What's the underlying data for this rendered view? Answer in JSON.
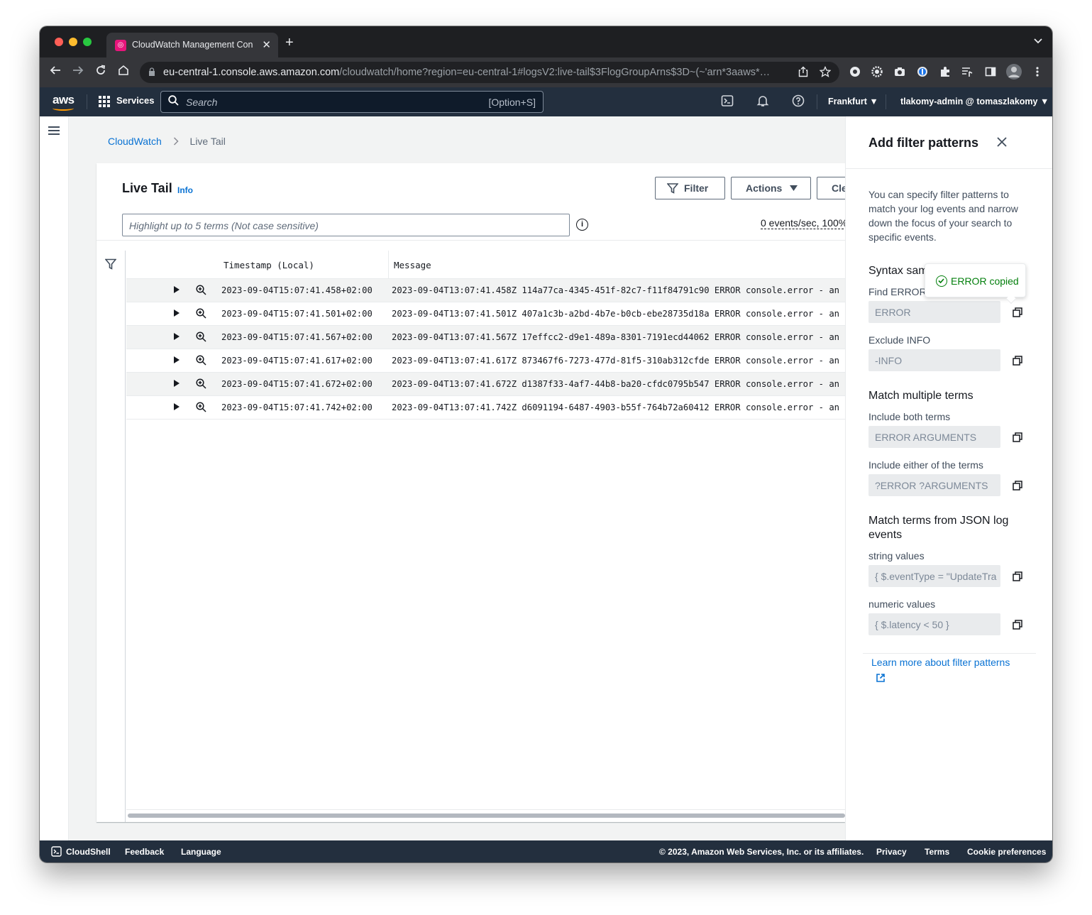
{
  "browser": {
    "tab_title": "CloudWatch Management Con",
    "url_host": "eu-central-1.console.aws.amazon.com",
    "url_path": "/cloudwatch/home?region=eu-central-1#logsV2:live-tail$3FlogGroupArns$3D~(~'arn*3aaws*…"
  },
  "aws_header": {
    "logo": "aws",
    "services_label": "Services",
    "search_placeholder": "Search",
    "search_shortcut": "[Option+S]",
    "region": "Frankfurt ▼",
    "user": "tlakomy-admin @ tomaszlakomy ▼"
  },
  "breadcrumb": {
    "root": "CloudWatch",
    "current": "Live Tail"
  },
  "live_tail": {
    "title": "Live Tail",
    "info_label": "Info",
    "filter_button": "Filter",
    "actions_button": "Actions",
    "clear_button": "Cle",
    "highlight_placeholder": "Highlight up to 5 terms (Not case sensitive)",
    "rate": "0 events/sec, 100%",
    "columns": [
      "Timestamp (Local)",
      "Message"
    ],
    "rows": [
      {
        "timestamp": "2023-09-04T15:07:41.458+02:00",
        "message": "2023-09-04T13:07:41.458Z 114a77ca-4345-451f-82c7-f11f84791c90 ERROR console.error - an er"
      },
      {
        "timestamp": "2023-09-04T15:07:41.501+02:00",
        "message": "2023-09-04T13:07:41.501Z 407a1c3b-a2bd-4b7e-b0cb-ebe28735d18a ERROR console.error - an er"
      },
      {
        "timestamp": "2023-09-04T15:07:41.567+02:00",
        "message": "2023-09-04T13:07:41.567Z 17effcc2-d9e1-489a-8301-7191ecd44062 ERROR console.error - an er"
      },
      {
        "timestamp": "2023-09-04T15:07:41.617+02:00",
        "message": "2023-09-04T13:07:41.617Z 873467f6-7273-477d-81f5-310ab312cfde ERROR console.error - an er"
      },
      {
        "timestamp": "2023-09-04T15:07:41.672+02:00",
        "message": "2023-09-04T13:07:41.672Z d1387f33-4af7-44b8-ba20-cfdc0795b547 ERROR console.error - an er"
      },
      {
        "timestamp": "2023-09-04T15:07:41.742+02:00",
        "message": "2023-09-04T13:07:41.742Z d6091194-6487-4903-b55f-764b72a60412 ERROR console.error - an er"
      }
    ]
  },
  "side_panel": {
    "title": "Add filter patterns",
    "description": "You can specify filter patterns to match your log events and narrow down the focus of your search to specific events.",
    "syntax_heading": "Syntax sam",
    "find_error_label": "Find ERROR",
    "find_error_value": "ERROR",
    "exclude_info_label": "Exclude INFO",
    "exclude_info_value": "-INFO",
    "match_multiple_heading": "Match multiple terms",
    "include_both_label": "Include both terms",
    "include_both_value": "ERROR ARGUMENTS",
    "include_either_label": "Include either of the terms",
    "include_either_value": "?ERROR ?ARGUMENTS",
    "json_heading": "Match terms from JSON log events",
    "string_label": "string values",
    "string_value": "{ $.eventType = \"UpdateTrail\" }",
    "numeric_label": "numeric values",
    "numeric_value": "{ $.latency < 50 }",
    "learn_more": "Learn more about filter patterns",
    "tooltip": "ERROR copied"
  },
  "footer": {
    "cloudshell": "CloudShell",
    "feedback": "Feedback",
    "language": "Language",
    "copyright": "© 2023, Amazon Web Services, Inc. or its affiliates.",
    "privacy": "Privacy",
    "terms": "Terms",
    "cookies": "Cookie preferences"
  },
  "colors": {
    "aws_navy": "#232f3e",
    "link_blue": "#0972d3",
    "success_green": "#037f0c",
    "aws_orange": "#ff9900"
  }
}
